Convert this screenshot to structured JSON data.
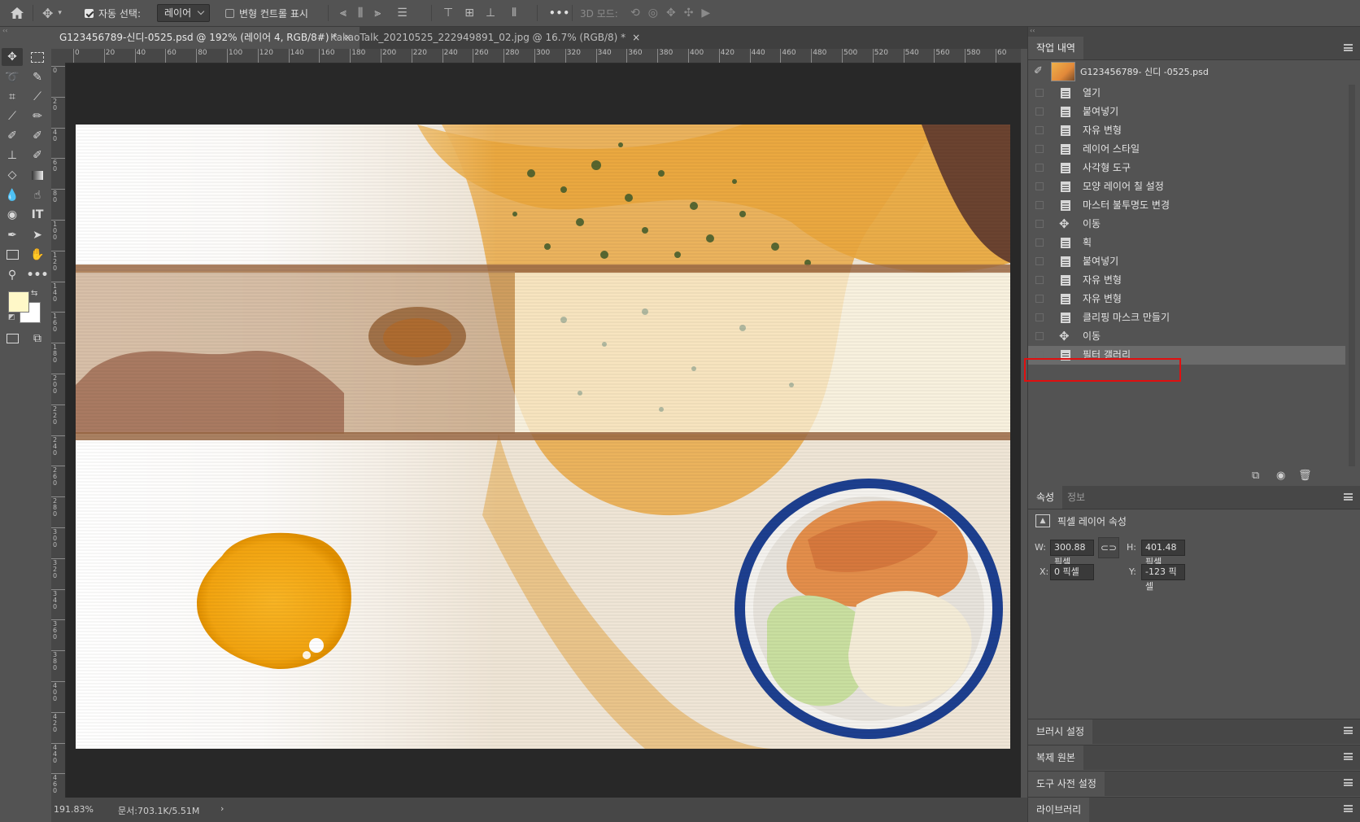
{
  "options_bar": {
    "auto_select_label": "자동 선택:",
    "auto_select_value": "레이어",
    "show_transform_label": "변형 컨트롤 표시",
    "more_label": "•••",
    "mode_3d_label": "3D 모드:"
  },
  "tabs": [
    {
      "label": "G123456789-신디-0525.psd @ 192% (레이어 4, RGB/8#) *",
      "close": "×"
    },
    {
      "label": "KakaoTalk_20210525_222949891_02.jpg @ 16.7% (RGB/8) *",
      "close": "×"
    }
  ],
  "ruler": {
    "h_ticks": [
      "0",
      "20",
      "40",
      "60",
      "80",
      "100",
      "120",
      "140",
      "160",
      "180",
      "200",
      "220",
      "240",
      "260",
      "280",
      "300",
      "320",
      "340",
      "360",
      "380",
      "400",
      "420",
      "440",
      "460",
      "480",
      "500",
      "520",
      "540",
      "560",
      "580",
      "60"
    ],
    "v_ticks": [
      "0",
      "20",
      "40",
      "60",
      "80",
      "100",
      "120",
      "140",
      "160",
      "180",
      "200",
      "220",
      "240",
      "260",
      "280",
      "300",
      "320",
      "340",
      "360",
      "380",
      "400",
      "420",
      "440",
      "460"
    ]
  },
  "status": {
    "zoom": "191.83%",
    "doc_info": "문서:703.1K/5.51M",
    "arrow": "›"
  },
  "history_panel": {
    "tab": "작업 내역",
    "snapshot_name": "G123456789- 신디 -0525.psd",
    "items": [
      {
        "label": "열기",
        "icon": "document-icon"
      },
      {
        "label": "붙여넣기",
        "icon": "document-icon"
      },
      {
        "label": "자유 변형",
        "icon": "document-icon"
      },
      {
        "label": "레이어 스타일",
        "icon": "document-icon"
      },
      {
        "label": "사각형 도구",
        "icon": "document-icon"
      },
      {
        "label": "모양 레이어 칠 설정",
        "icon": "document-icon"
      },
      {
        "label": "마스터 불투명도 변경",
        "icon": "document-icon"
      },
      {
        "label": "이동",
        "icon": "move-icon"
      },
      {
        "label": "획",
        "icon": "document-icon"
      },
      {
        "label": "붙여넣기",
        "icon": "document-icon"
      },
      {
        "label": "자유 변형",
        "icon": "document-icon"
      },
      {
        "label": "자유 변형",
        "icon": "document-icon"
      },
      {
        "label": "클리핑 마스크 만들기",
        "icon": "document-icon"
      },
      {
        "label": "이동",
        "icon": "move-icon"
      },
      {
        "label": "필터 갤러리",
        "icon": "document-icon"
      }
    ],
    "selected_index": 14,
    "highlight_color": "#e01010"
  },
  "properties_panel": {
    "tab_properties": "속성",
    "tab_info": "정보",
    "title": "픽셀 레이어 속성",
    "w_label": "W:",
    "w_value": "300.88 픽셀",
    "h_label": "H:",
    "h_value": "401.48 픽셀",
    "x_label": "X:",
    "x_value": "0 픽셀",
    "y_label": "Y:",
    "y_value": "-123 픽셀"
  },
  "collapsed_panels": [
    "브러시 설정",
    "복제 원본",
    "도구 사전 설정",
    "라이브러리"
  ],
  "colors": {
    "foreground": "#fff8c8",
    "background": "#ffffff",
    "highlight": "#e01010"
  }
}
